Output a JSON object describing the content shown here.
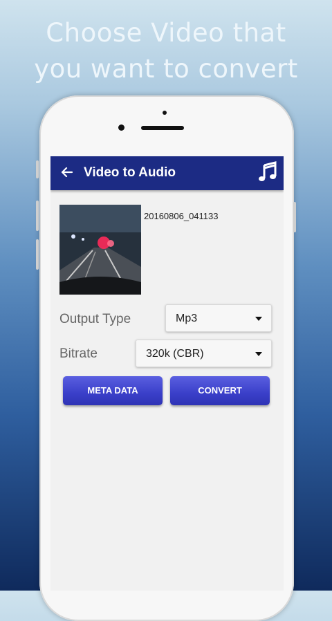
{
  "headline": {
    "line1": "Choose Video that",
    "line2": "you want to convert"
  },
  "appbar": {
    "title": "Video to Audio",
    "back_icon": "arrow-left-icon",
    "action_icon": "music-note-icon",
    "color": "#1c2b84"
  },
  "video": {
    "filename": "20160806_041133"
  },
  "form": {
    "output_type_label": "Output Type",
    "output_type_value": "Mp3",
    "bitrate_label": "Bitrate",
    "bitrate_value": "320k (CBR)"
  },
  "buttons": {
    "meta_data": "META DATA",
    "convert": "CONVERT",
    "color": "#3a3fc9"
  }
}
